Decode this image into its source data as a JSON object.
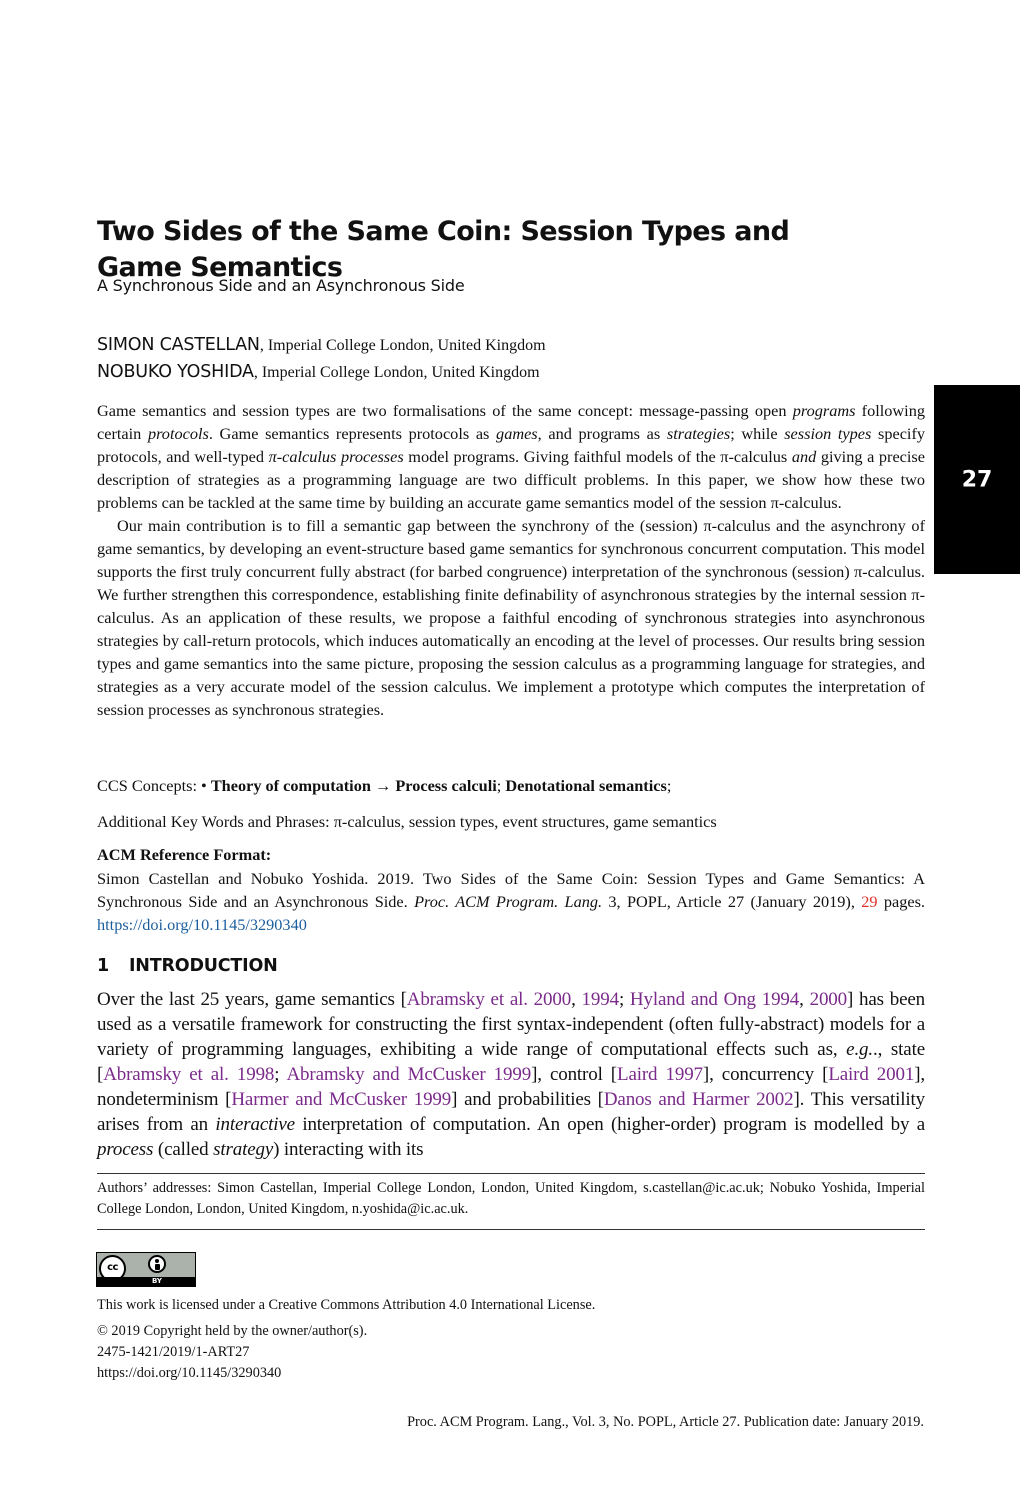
{
  "title": "Two Sides of the Same Coin: Session Types and Game Semantics",
  "subtitle": "A Synchronous Side and an Asynchronous Side",
  "authors": [
    {
      "name": "SIMON CASTELLAN",
      "affiliation": ", Imperial College London, United Kingdom"
    },
    {
      "name": "NOBUKO YOSHIDA",
      "affiliation": ", Imperial College London, United Kingdom"
    }
  ],
  "article_tab": "27",
  "abstract": {
    "p1": [
      {
        "t": "Game semantics and session types are two formalisations of the same concept: message-passing open "
      },
      {
        "t": "programs",
        "i": true
      },
      {
        "t": " following certain "
      },
      {
        "t": "protocols",
        "i": true
      },
      {
        "t": ". Game semantics represents protocols as "
      },
      {
        "t": "games",
        "i": true
      },
      {
        "t": ", and programs as "
      },
      {
        "t": "strategies",
        "i": true
      },
      {
        "t": "; while "
      },
      {
        "t": "session types",
        "i": true
      },
      {
        "t": " specify protocols, and well-typed "
      },
      {
        "t": "π-calculus processes",
        "i": true
      },
      {
        "t": " model programs. Giving faithful models of the π-calculus "
      },
      {
        "t": "and",
        "i": true
      },
      {
        "t": " giving a precise description of strategies as a programming language are two difficult problems. In this paper, we show how these two problems can be tackled at the same time by building an accurate game semantics model of the session π-calculus."
      }
    ],
    "p2": "Our main contribution is to fill a semantic gap between the synchrony of the (session) π-calculus and the asynchrony of game semantics, by developing an event-structure based game semantics for synchronous concurrent computation. This model supports the first truly concurrent fully abstract (for barbed congruence) interpretation of the synchronous (session) π-calculus. We further strengthen this correspondence, establishing finite definability of asynchronous strategies by the internal session π-calculus. As an application of these results, we propose a faithful encoding of synchronous strategies into asynchronous strategies by call-return protocols, which induces automatically an encoding at the level of processes. Our results bring session types and game semantics into the same picture, proposing the session calculus as a programming language for strategies, and strategies as a very accurate model of the session calculus. We implement a prototype which computes the interpretation of session processes as synchronous strategies."
  },
  "ccs": {
    "label": "CCS Concepts: • ",
    "concept": "Theory of computation",
    "arrow": " → ",
    "item1": "Process calculi",
    "sep": "; ",
    "item2": "Denotational semantics",
    "end": ";"
  },
  "keywords": "Additional Key Words and Phrases: π-calculus, session types, event structures, game semantics",
  "acm_reference": {
    "heading": "ACM Reference Format:",
    "text_before": "Simon Castellan and Nobuko Yoshida. 2019. Two Sides of the Same Coin: Session Types and Game Semantics: A Synchronous Side and an Asynchronous Side. ",
    "journal": "Proc. ACM Program. Lang.",
    "text_after": " 3, POPL, Article 27 (January 2019), ",
    "pages": "29",
    "pages_suffix": " pages. ",
    "doi": "https://doi.org/10.1145/3290340"
  },
  "section": {
    "number": "1",
    "title": "INTRODUCTION"
  },
  "intro": [
    {
      "t": "Over the last 25 years, game semantics ["
    },
    {
      "t": "Abramsky et al. 2000",
      "c": true
    },
    {
      "t": ", "
    },
    {
      "t": "1994",
      "c": true
    },
    {
      "t": "; "
    },
    {
      "t": "Hyland and Ong 1994",
      "c": true
    },
    {
      "t": ", "
    },
    {
      "t": "2000",
      "c": true
    },
    {
      "t": "] has been used as a versatile framework for constructing the first syntax-independent (often fully-abstract) models for a variety of programming languages, exhibiting a wide range of computational effects such as, "
    },
    {
      "t": "e.g.",
      "i": true
    },
    {
      "t": "., state ["
    },
    {
      "t": "Abramsky et al. 1998",
      "c": true
    },
    {
      "t": "; "
    },
    {
      "t": "Abramsky and McCusker 1999",
      "c": true
    },
    {
      "t": "], control ["
    },
    {
      "t": "Laird 1997",
      "c": true
    },
    {
      "t": "], concurrency ["
    },
    {
      "t": "Laird 2001",
      "c": true
    },
    {
      "t": "], nondeterminism ["
    },
    {
      "t": "Harmer and McCusker 1999",
      "c": true
    },
    {
      "t": "] and probabilities ["
    },
    {
      "t": "Danos and Harmer 2002",
      "c": true
    },
    {
      "t": "]. This versatility arises from an "
    },
    {
      "t": "interactive",
      "i": true
    },
    {
      "t": " interpretation of computation. An open (higher-order) program is modelled by a "
    },
    {
      "t": "process",
      "i": true
    },
    {
      "t": " (called "
    },
    {
      "t": "strategy",
      "i": true
    },
    {
      "t": ") interacting with its"
    }
  ],
  "footnote": "Authors’ addresses: Simon Castellan, Imperial College London, London, United Kingdom, s.castellan@ic.ac.uk; Nobuko Yoshida, Imperial College London, London, United Kingdom, n.yoshida@ic.ac.uk.",
  "license": {
    "badge_left": "cc",
    "badge_label": "BY",
    "statement": "This work is licensed under a Creative Commons Attribution 4.0 International License.",
    "copyright": "© 2019 Copyright held by the owner/author(s).",
    "issn": "2475-1421/2019/1-ART27",
    "doi": "https://doi.org/10.1145/3290340"
  },
  "footer": "Proc. ACM Program. Lang., Vol. 3, No. POPL, Article 27. Publication date: January 2019.",
  "colors": {
    "citation": "#7a2a8a",
    "link": "#1b5e9e",
    "page_count": "#e0302a",
    "tab_bg": "#000000"
  }
}
